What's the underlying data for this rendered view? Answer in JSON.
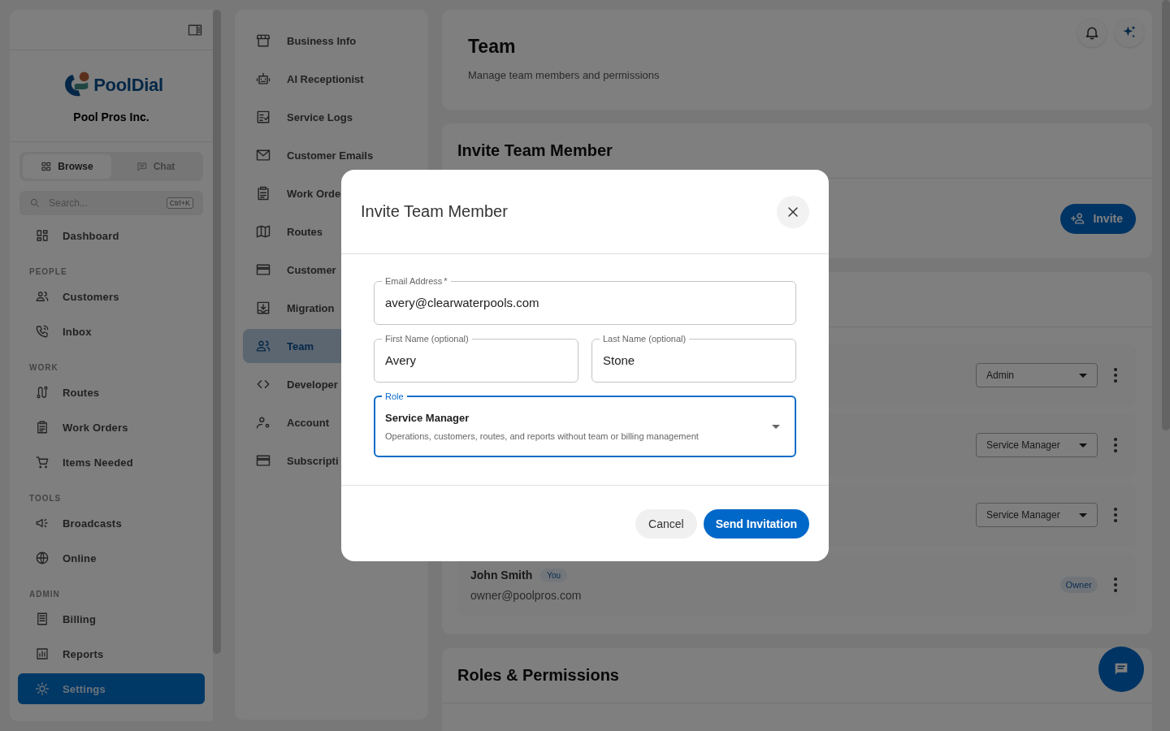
{
  "sidebar": {
    "brand": "PoolDial",
    "workspace": "Pool Pros Inc.",
    "modes": [
      {
        "label": "Browse",
        "selected": true
      },
      {
        "label": "Chat",
        "selected": false
      }
    ],
    "search": {
      "placeholder": "Search...",
      "shortcut": "Ctrl+K"
    },
    "groups": [
      {
        "items": [
          {
            "label": "Dashboard",
            "selected": false
          }
        ]
      },
      {
        "heading": "PEOPLE",
        "items": [
          {
            "label": "Customers",
            "selected": false
          },
          {
            "label": "Inbox",
            "selected": false
          }
        ]
      },
      {
        "heading": "WORK",
        "items": [
          {
            "label": "Routes",
            "selected": false
          },
          {
            "label": "Work Orders",
            "selected": false
          },
          {
            "label": "Items Needed",
            "selected": false
          }
        ]
      },
      {
        "heading": "TOOLS",
        "items": [
          {
            "label": "Broadcasts",
            "selected": false
          },
          {
            "label": "Online",
            "selected": false
          }
        ]
      },
      {
        "heading": "ADMIN",
        "items": [
          {
            "label": "Billing",
            "selected": false
          },
          {
            "label": "Reports",
            "selected": false
          },
          {
            "label": "Settings",
            "selected": true
          }
        ]
      }
    ]
  },
  "settings_nav": [
    {
      "label": "Business Info",
      "selected": false
    },
    {
      "label": "AI Receptionist",
      "selected": false
    },
    {
      "label": "Service Logs",
      "selected": false
    },
    {
      "label": "Customer Emails",
      "selected": false
    },
    {
      "label": "Work Orde",
      "selected": false
    },
    {
      "label": "Routes",
      "selected": false
    },
    {
      "label": "Customer",
      "selected": false
    },
    {
      "label": "Migration",
      "selected": false
    },
    {
      "label": "Team",
      "selected": true
    },
    {
      "label": "Developer",
      "selected": false
    },
    {
      "label": "Account",
      "selected": false
    },
    {
      "label": "Subscripti",
      "selected": false
    }
  ],
  "header": {
    "title": "Team",
    "subtitle": "Manage team members and permissions"
  },
  "invite_card": {
    "title": "Invite Team Member",
    "button": "Invite"
  },
  "members": [
    {
      "kind": "select",
      "role": "Admin"
    },
    {
      "kind": "select",
      "role": "Service Manager"
    },
    {
      "kind": "select",
      "role": "Service Manager"
    },
    {
      "kind": "owner",
      "name": "John Smith",
      "badge": "You",
      "email": "owner@poolpros.com",
      "role": "Owner"
    }
  ],
  "roles_card": {
    "title": "Roles & Permissions"
  },
  "dialog": {
    "title": "Invite Team Member",
    "email": {
      "label": "Email Address",
      "required_mark": "*",
      "value": "avery@clearwaterpools.com",
      "focused": false
    },
    "names": [
      {
        "label": "First Name (optional)",
        "value": "Avery",
        "focused": false
      },
      {
        "label": "Last Name (optional)",
        "value": "Stone",
        "focused": false
      }
    ],
    "role": {
      "label": "Role",
      "value": "Service Manager",
      "description": "Operations, customers, routes, and reports without team or billing management",
      "focused": true
    },
    "cancel": "Cancel",
    "submit": "Send Invitation"
  }
}
